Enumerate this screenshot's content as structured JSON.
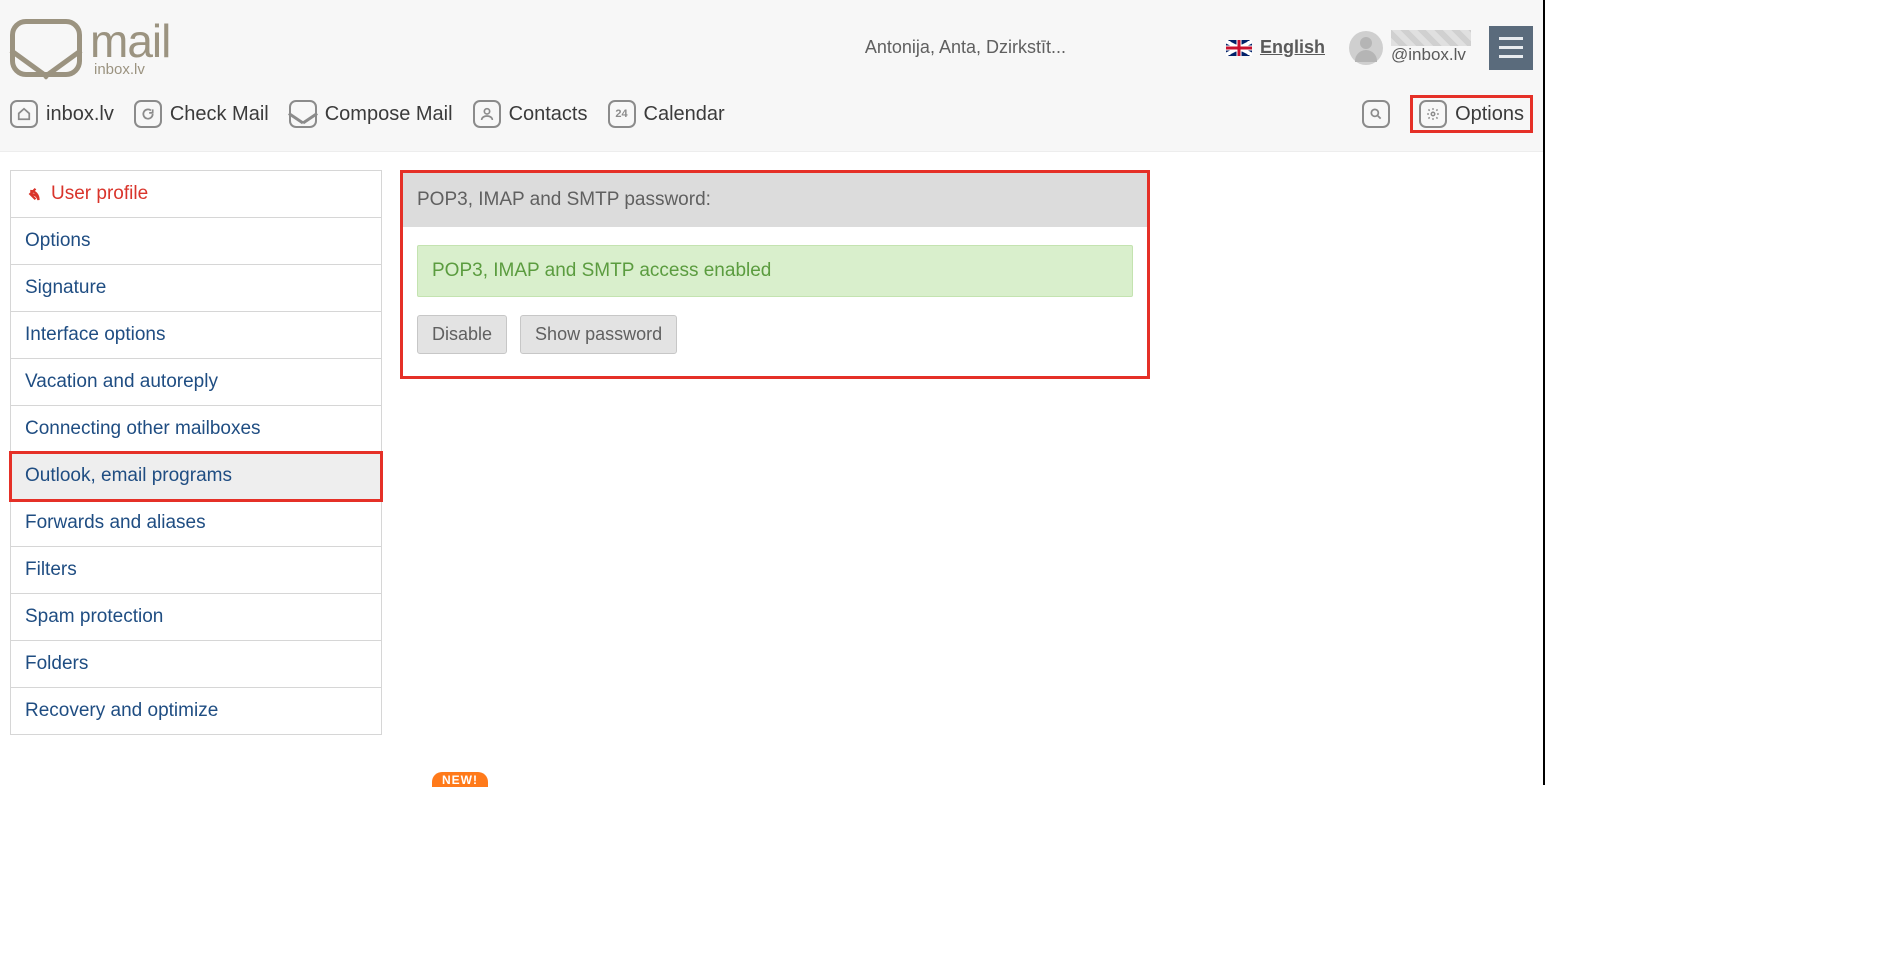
{
  "brand": {
    "name": "mail",
    "sub": "inbox.lv"
  },
  "header": {
    "now_playing": "Antonija, Anta, Dzirkstīt...",
    "language": "English",
    "user_domain": "@inbox.lv"
  },
  "nav": {
    "home": "inbox.lv",
    "check": "Check Mail",
    "compose": "Compose Mail",
    "contacts": "Contacts",
    "calendar": "Calendar",
    "calendar_day": "24",
    "options": "Options"
  },
  "sidebar": {
    "profile": "User profile",
    "items": [
      "Options",
      "Signature",
      "Interface options",
      "Vacation and autoreply",
      "Connecting other mailboxes",
      "Outlook, email programs",
      "Forwards and aliases",
      "Filters",
      "Spam protection",
      "Folders",
      "Recovery and optimize"
    ],
    "active_index": 5
  },
  "panel": {
    "title": "POP3, IMAP and SMTP password:",
    "status": "POP3, IMAP and SMTP access enabled",
    "disable_btn": "Disable",
    "show_pw_btn": "Show password"
  },
  "badge": "NEW!"
}
